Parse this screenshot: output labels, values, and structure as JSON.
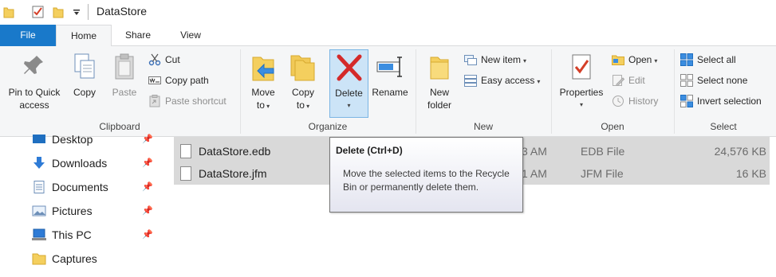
{
  "window": {
    "title": "DataStore"
  },
  "tabs": [
    {
      "label": "File"
    },
    {
      "label": "Home"
    },
    {
      "label": "Share"
    },
    {
      "label": "View"
    }
  ],
  "ribbon": {
    "clipboard": {
      "label": "Clipboard",
      "pin_label_1": "Pin to Quick",
      "pin_label_2": "access",
      "copy": "Copy",
      "paste": "Paste",
      "cut": "Cut",
      "copy_path": "Copy path",
      "paste_shortcut": "Paste shortcut"
    },
    "organize": {
      "label": "Organize",
      "move_to_1": "Move",
      "move_to_2": "to",
      "copy_to_1": "Copy",
      "copy_to_2": "to",
      "delete": "Delete",
      "rename": "Rename"
    },
    "new": {
      "label": "New",
      "new_folder_1": "New",
      "new_folder_2": "folder",
      "new_item": "New item",
      "easy_access": "Easy access"
    },
    "open": {
      "label": "Open",
      "properties": "Properties",
      "open": "Open",
      "edit": "Edit",
      "history": "History"
    },
    "select": {
      "label": "Select",
      "select_all": "Select all",
      "select_none": "Select none",
      "invert_selection": "Invert selection"
    }
  },
  "nav": {
    "items": [
      {
        "label": "Desktop",
        "icon": "desktop-icon",
        "pinned": true
      },
      {
        "label": "Downloads",
        "icon": "download-arrow-icon",
        "pinned": true
      },
      {
        "label": "Documents",
        "icon": "documents-icon",
        "pinned": true
      },
      {
        "label": "Pictures",
        "icon": "pictures-icon",
        "pinned": true
      },
      {
        "label": "This PC",
        "icon": "computer-icon",
        "pinned": true
      },
      {
        "label": "Captures",
        "icon": "folder-icon",
        "pinned": false
      }
    ]
  },
  "files": [
    {
      "name": "DataStore.edb",
      "date_fragment": "3 AM",
      "type": "EDB File",
      "size": "24,576 KB"
    },
    {
      "name": "DataStore.jfm",
      "date_fragment": "1 AM",
      "type": "JFM File",
      "size": "16 KB"
    }
  ],
  "tooltip": {
    "title": "Delete (Ctrl+D)",
    "body": "Move the selected items to the Recycle Bin or permanently delete them."
  },
  "colors": {
    "file_tab": "#1979ca",
    "ribbon_bg": "#f5f6f7",
    "pressed": "#cce4f7",
    "selected_row": "#d9d9d9",
    "delete_x": "#d42a2a",
    "folder": "#f4cf5e"
  }
}
